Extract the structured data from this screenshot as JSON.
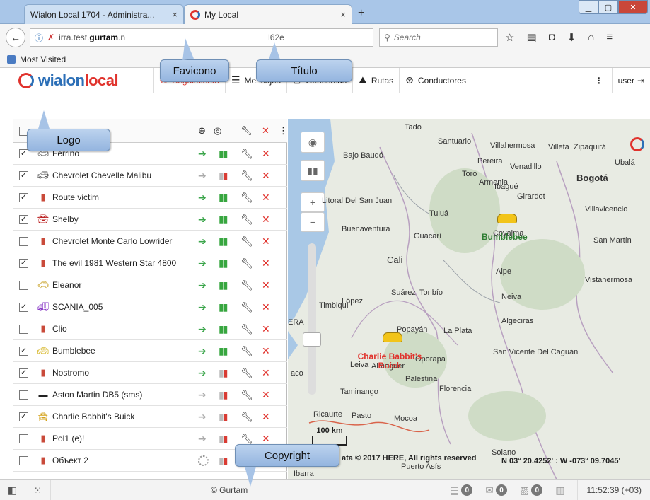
{
  "browser": {
    "tabs": [
      {
        "title": "Wialon Local 1704 - Administra...",
        "close": "×"
      },
      {
        "title": "My Local",
        "close": "×"
      }
    ],
    "newtab": "+",
    "url": {
      "prefix": "irra.test.",
      "domain": "gurtam",
      "suffix": ".n",
      "tail": "l62e"
    },
    "search_placeholder": "Search",
    "bookmarks_label": "Most Visited"
  },
  "app": {
    "logo_main": "wialon",
    "logo_accent": "local",
    "menu": [
      {
        "label": "Seguimiento",
        "icon": "globe-icon"
      },
      {
        "label": "Mensajes",
        "icon": "messages-icon"
      },
      {
        "label": "Geocercas",
        "icon": "geofence-icon"
      },
      {
        "label": "Rutas",
        "icon": "routes-icon"
      },
      {
        "label": "Conductores",
        "icon": "drivers-icon"
      }
    ],
    "more": "⋮",
    "user": "user"
  },
  "units": [
    {
      "name": "Ferrino",
      "checked": true
    },
    {
      "name": "Chevrolet Chevelle Malibu",
      "checked": true
    },
    {
      "name": "Route victim",
      "checked": true
    },
    {
      "name": "Shelby",
      "checked": true
    },
    {
      "name": "Chevrolet Monte Carlo Lowrider",
      "checked": false
    },
    {
      "name": "The evil 1981 Western Star 4800",
      "checked": true
    },
    {
      "name": "Eleanor",
      "checked": false
    },
    {
      "name": "SCANIA_005",
      "checked": true
    },
    {
      "name": "Clio",
      "checked": false
    },
    {
      "name": "Bumblebee",
      "checked": true
    },
    {
      "name": "Nostromo",
      "checked": true
    },
    {
      "name": "Aston Martin DB5 (sms)",
      "checked": false
    },
    {
      "name": "Charlie Babbit's Buick",
      "checked": true
    },
    {
      "name": "Pol1 (e)!",
      "checked": false
    },
    {
      "name": "Объект 2",
      "checked": false
    }
  ],
  "map": {
    "places": [
      "Tadó",
      "Santuario",
      "Villahermosa",
      "Villeta",
      "Zipaquirá",
      "Bajo Baudó",
      "Pereira",
      "Venadillo",
      "Ubalá",
      "Toro",
      "Armenia",
      "Ibagué",
      "Girardot",
      "Bogotá",
      "Litoral Del San Juan",
      "Tuluá",
      "Villavicencio",
      "Buenaventura",
      "Guacarí",
      "Coyaima",
      "San Martín",
      "Cali",
      "Aipe",
      "Vistahermosa",
      "Suárez",
      "Toribío",
      "Neiva",
      "Timbiquí",
      "López",
      "Algeciras",
      "ERA",
      "Popayán",
      "La Plata",
      "San Vicente Del Caguán",
      "Leiva",
      "Almaguer",
      "Oporapa",
      "Palestina",
      "Florencia",
      "aco",
      "Taminango",
      "Ricaurte",
      "Pasto",
      "Mocoa",
      "Solano",
      "Puerto Asís",
      "Ibarra"
    ],
    "unit_labels": [
      "Bumblebee",
      "Charlie Babbit's Buick"
    ],
    "scale": "100 km",
    "copyright": "ata © 2017 HERE, All rights reserved",
    "coords": "N 03° 20.4252' : W -073° 09.7045'"
  },
  "statusbar": {
    "copyright": "© Gurtam",
    "badges": [
      "0",
      "0",
      "0"
    ],
    "time": "11:52:39 (+03)"
  },
  "callouts": {
    "favicon": "Favicono",
    "title": "Título",
    "logo": "Logo",
    "copyright": "Copyright"
  }
}
